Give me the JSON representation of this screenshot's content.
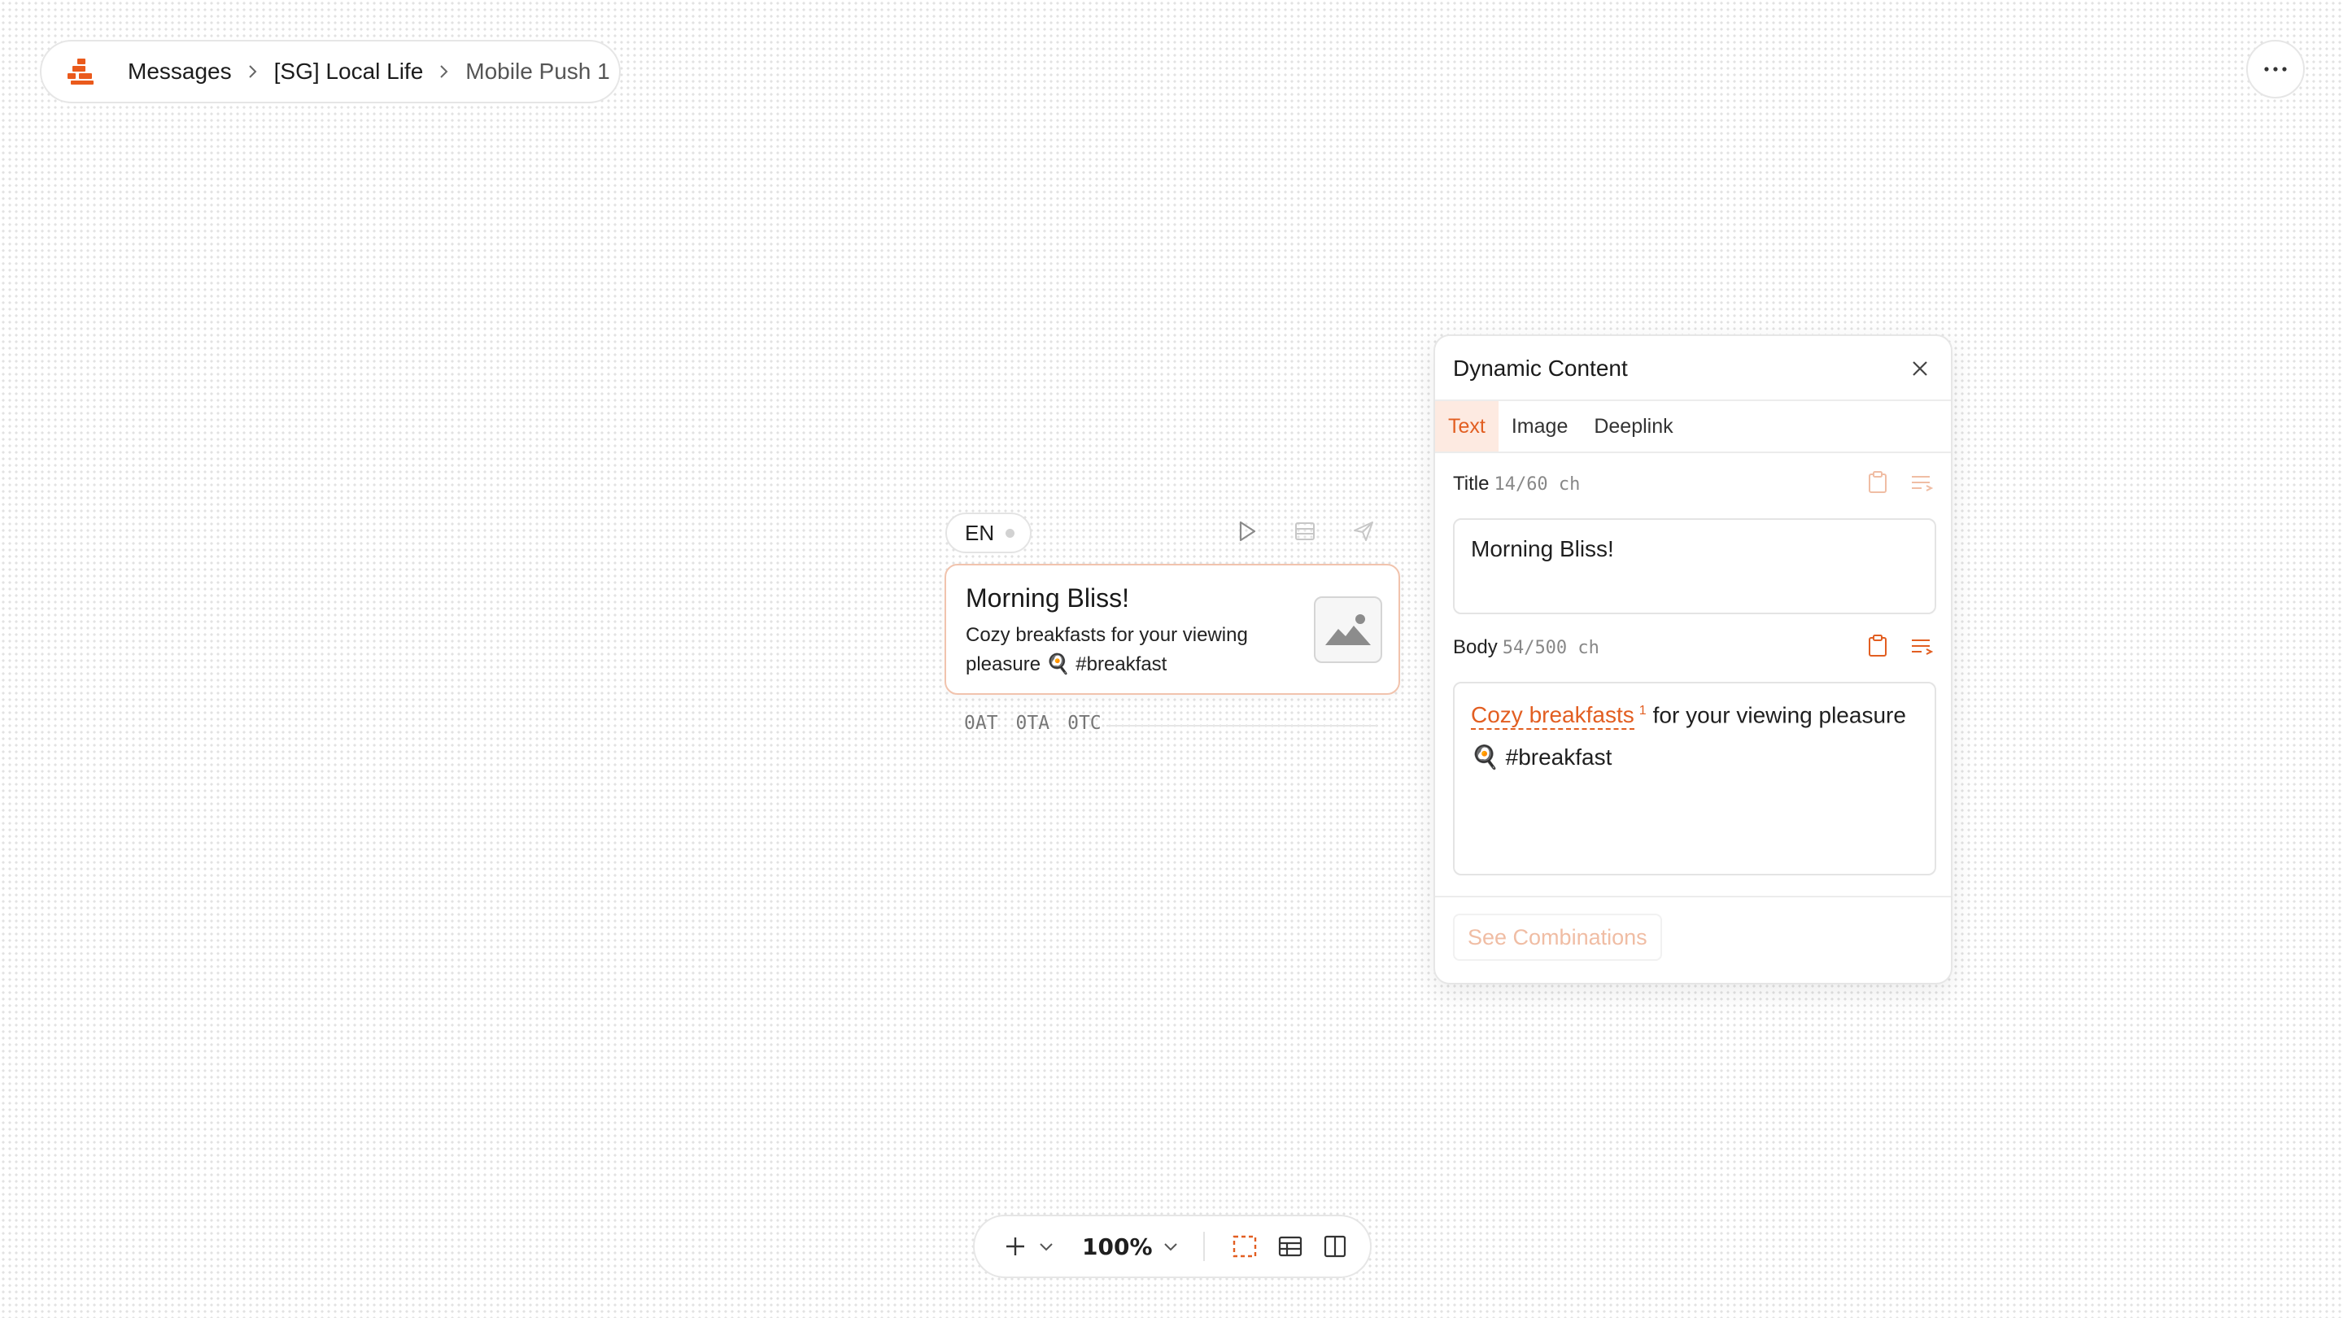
{
  "breadcrumb": {
    "items": [
      "Messages",
      "[SG] Local Life",
      "Mobile Push 1"
    ]
  },
  "card": {
    "lang": "EN",
    "title": "Morning Bliss!",
    "body": "Cozy breakfasts for your viewing pleasure 🍳 #breakfast",
    "stats": [
      "0AT",
      "0TA",
      "0TC"
    ]
  },
  "panel": {
    "title": "Dynamic Content",
    "tabs": [
      "Text",
      "Image",
      "Deeplink"
    ],
    "active_tab": "Text",
    "title_field": {
      "label": "Title",
      "count": "14/60 ch",
      "value": "Morning Bliss!"
    },
    "body_field": {
      "label": "Body",
      "count": "54/500 ch",
      "dynamic_text": "Cozy breakfasts",
      "dynamic_index": "1",
      "rest_line1": "for your viewing pleasure",
      "rest_line2": "🍳 #breakfast"
    },
    "see_button": "See Combinations"
  },
  "toolbar": {
    "zoom": "100%"
  },
  "colors": {
    "accent": "#e25e21",
    "accent_light": "#fdeae1",
    "border": "#e6e6e6"
  }
}
